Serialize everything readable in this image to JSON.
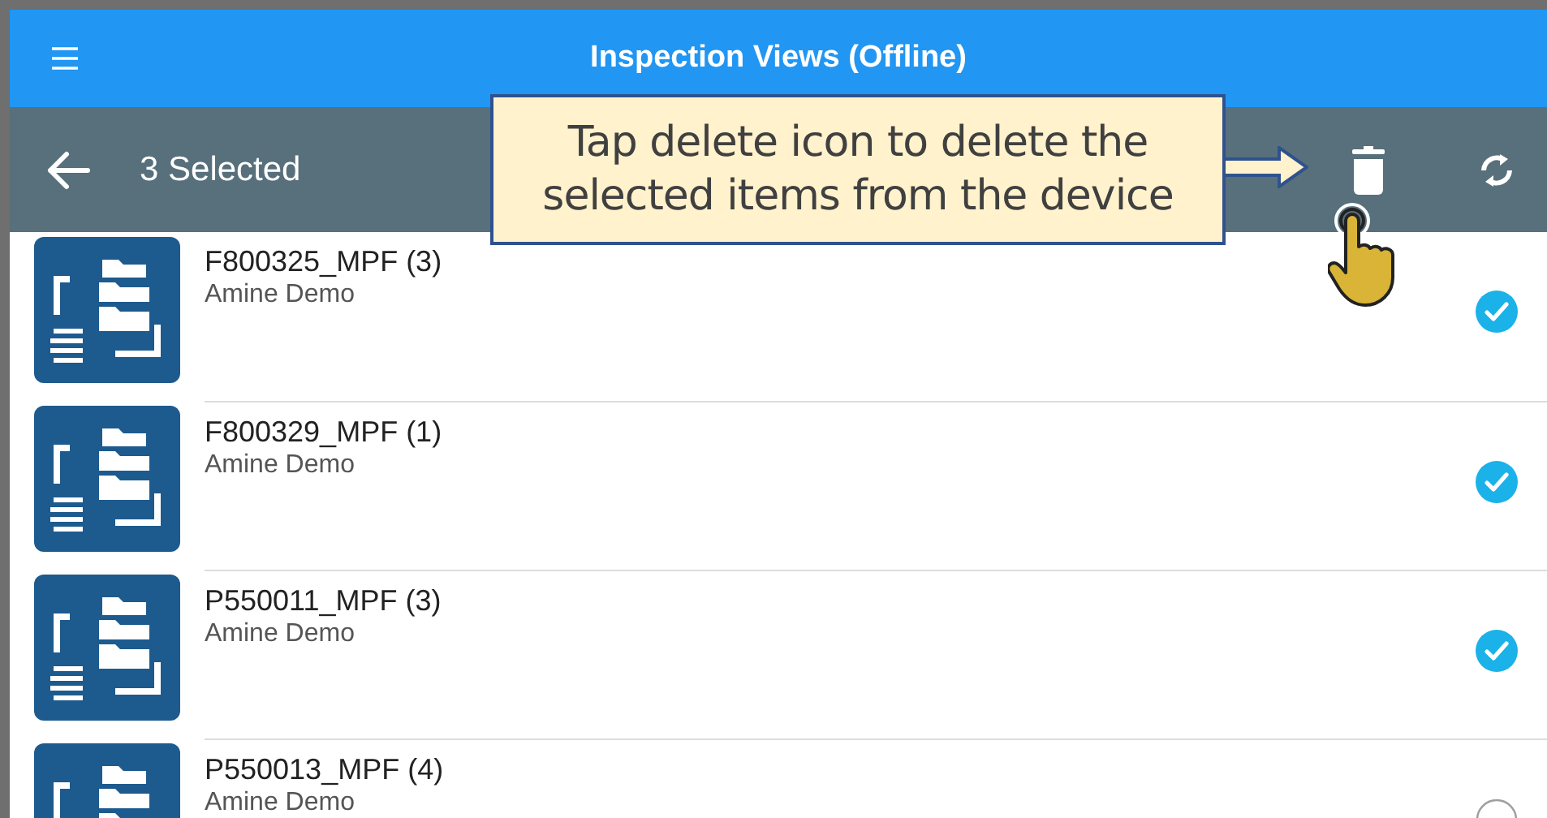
{
  "header": {
    "title": "Inspection Views (Offline)"
  },
  "toolbar": {
    "selection_count": "3 Selected"
  },
  "callout": {
    "text": "Tap delete icon to delete the selected items from the device"
  },
  "items": [
    {
      "title": "F800325_MPF (3)",
      "subtitle": "Amine Demo",
      "selected": true
    },
    {
      "title": "F800329_MPF (1)",
      "subtitle": "Amine Demo",
      "selected": true
    },
    {
      "title": "P550011_MPF (3)",
      "subtitle": "Amine Demo",
      "selected": true
    },
    {
      "title": "P550013_MPF (4)",
      "subtitle": "Amine Demo",
      "selected": false
    }
  ]
}
